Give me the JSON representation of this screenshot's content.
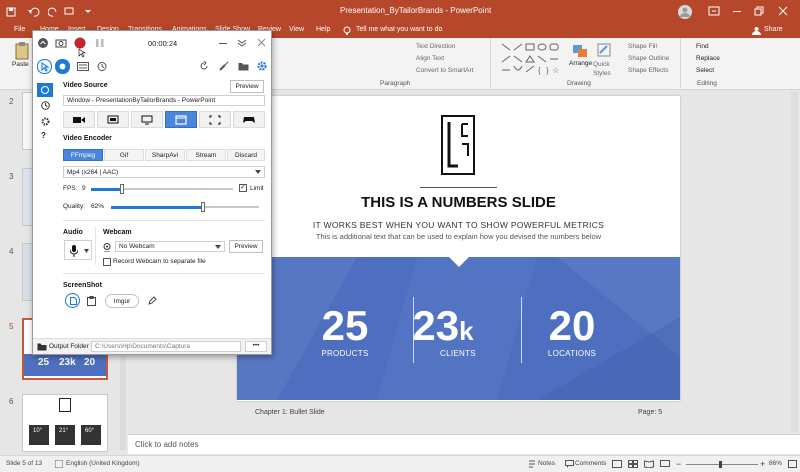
{
  "titlebar": {
    "doc_title": "Presentation_ByTailorBrands  -  PowerPoint"
  },
  "tabs": [
    "File",
    "Home",
    "Insert",
    "Design",
    "Transitions",
    "Animations",
    "Slide Show",
    "Review",
    "View",
    "Help"
  ],
  "tell_me": "Tell me what you want to do",
  "share": "Share",
  "ribbon": {
    "paste": "Paste",
    "text_direction": "Text Direction",
    "align_text": "Align Text",
    "convert_smartart": "Convert to SmartArt",
    "arrange": "Arrange",
    "quick_styles": "Quick Styles",
    "shape_fill": "Shape Fill",
    "shape_outline": "Shape Outline",
    "shape_effects": "Shape Effects",
    "find": "Find",
    "replace": "Replace",
    "select": "Select",
    "group_paragraph": "Paragraph",
    "group_drawing": "Drawing",
    "group_editing": "Editing"
  },
  "thumbnails": {
    "numbers": [
      "2",
      "3",
      "4",
      "5",
      "6"
    ],
    "slide6_values": [
      "10°",
      "21°",
      "60°"
    ],
    "slide5_values": [
      "25",
      "23k",
      "20"
    ]
  },
  "slide": {
    "title": "THIS IS A NUMBERS SLIDE",
    "subtitle": "IT WORKS BEST WHEN YOU WANT TO SHOW POWERFUL METRICS",
    "body": "This is additional text that can be used to explain how you devised the numbers below",
    "stats": [
      {
        "value": "25",
        "label": "PRODUCTS"
      },
      {
        "value": "23",
        "suffix": "k",
        "label": "CLIENTS"
      },
      {
        "value": "20",
        "label": "LOCATIONS"
      }
    ],
    "footer_left": "Chapter 1: Bullet Slide",
    "footer_right": "Page: 5"
  },
  "notes_placeholder": "Click to add notes",
  "status": {
    "slide_of": "Slide 5 of 13",
    "language": "English (United Kingdom)",
    "notes": "Notes",
    "comments": "Comments",
    "zoom": "86%"
  },
  "captura": {
    "timer": "00:00:24",
    "video_source": "Video Source",
    "preview": "Preview",
    "source_value": "Window  -  PresentationByTailorBrands - PowerPoint",
    "video_encoder": "Video Encoder",
    "encoders": [
      "FFmpeg",
      "Gif",
      "SharpAvi",
      "Stream",
      "Discard"
    ],
    "codec": "Mp4 (x264 | AAC)",
    "fps_label": "FPS:",
    "fps_value": "9",
    "fps_fraction": 0.22,
    "limit": "Limit",
    "quality_label": "Quality:",
    "quality_value": "62%",
    "quality_fraction": 0.62,
    "audio": "Audio",
    "webcam": "Webcam",
    "webcam_value": "No Webcam",
    "webcam_preview": "Preview",
    "record_webcam": "Record Webcam to separate file",
    "screenshot": "ScreenShot",
    "imgur": "Imgur",
    "output_folder": "Output Folder",
    "output_path": "C:\\Users\\Hp\\Documents\\Captura",
    "more": "•••"
  },
  "colors": {
    "ppt_accent": "#b7472a",
    "captura_accent": "#1e78d7",
    "slide_band": "#4e6fbf",
    "seg_active": "#4a86d9"
  }
}
